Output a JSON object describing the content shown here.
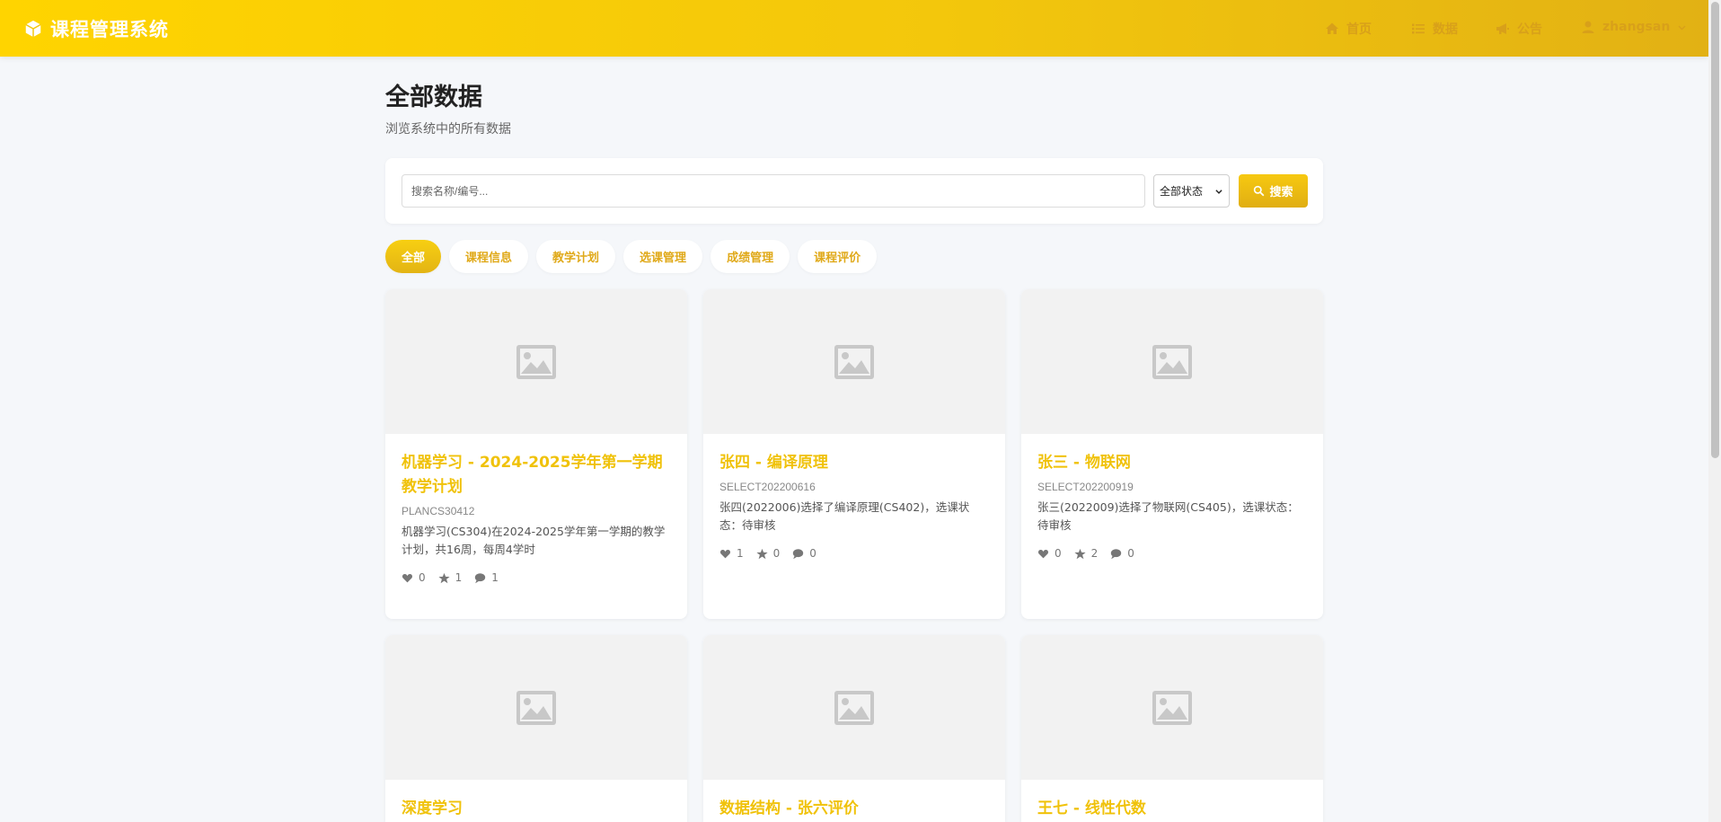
{
  "header": {
    "brand": "课程管理系统",
    "nav": {
      "home": "首页",
      "data": "数据",
      "notice": "公告",
      "user": "zhangsan"
    }
  },
  "page": {
    "title": "全部数据",
    "subtitle": "浏览系统中的所有数据"
  },
  "search": {
    "placeholder": "搜索名称/编号...",
    "status_selected": "全部状态",
    "button": "搜索"
  },
  "filters": [
    "全部",
    "课程信息",
    "教学计划",
    "选课管理",
    "成绩管理",
    "课程评价"
  ],
  "cards": [
    {
      "title": "机器学习 - 2024-2025学年第一学期教学计划",
      "code": "PLANCS30412",
      "desc": "机器学习(CS304)在2024-2025学年第一学期的教学计划，共16周，每周4学时",
      "likes": "0",
      "stars": "1",
      "comments": "1"
    },
    {
      "title": "张四 - 编译原理",
      "code": "SELECT202200616",
      "desc": "张四(2022006)选择了编译原理(CS402)，选课状态：待审核",
      "likes": "1",
      "stars": "0",
      "comments": "0"
    },
    {
      "title": "张三 - 物联网",
      "code": "SELECT202200919",
      "desc": "张三(2022009)选择了物联网(CS405)，选课状态：待审核",
      "likes": "0",
      "stars": "2",
      "comments": "0"
    },
    {
      "title": "深度学习"
    },
    {
      "title": "数据结构 - 张六评价"
    },
    {
      "title": "王七 - 线性代数"
    }
  ],
  "colors": {
    "accent": "#f0c20a",
    "header_start": "#ffd400",
    "header_end": "#e2b114"
  }
}
